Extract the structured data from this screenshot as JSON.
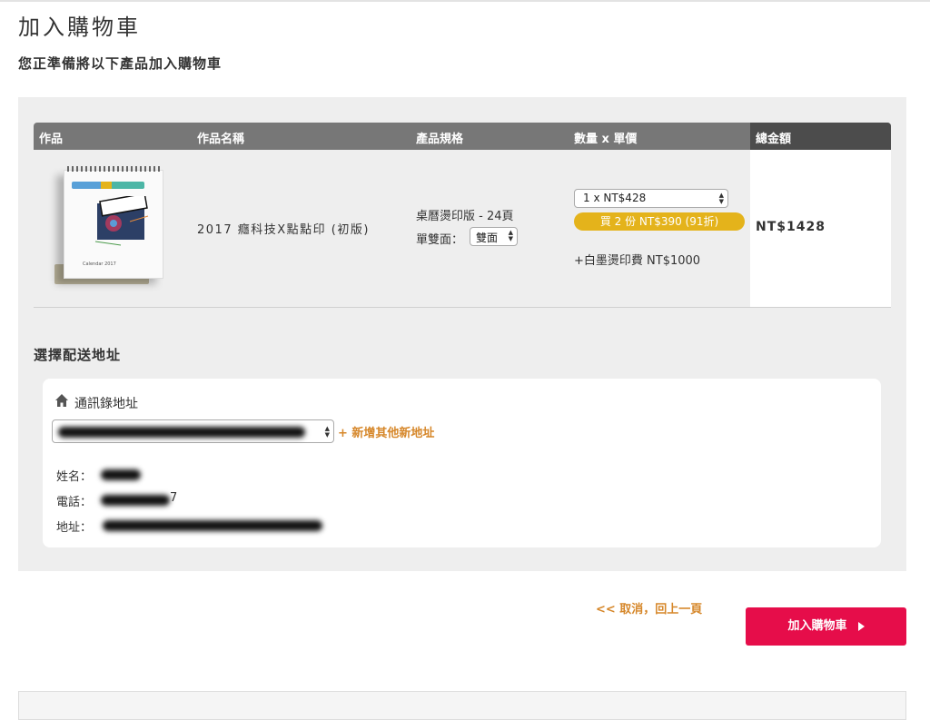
{
  "page": {
    "title": "加入購物車",
    "subtitle": "您正準備將以下產品加入購物車"
  },
  "table": {
    "headers": {
      "work": "作品",
      "name": "作品名稱",
      "spec": "產品規格",
      "qty_price": "數量 x 單價",
      "total": "總金額"
    },
    "row": {
      "thumbnail_caption": "Calendar 2017",
      "product_name": "2017 癮科技X點點印 (初版)",
      "spec_line": "桌曆燙印版 - 24頁",
      "sides_label": "單雙面：",
      "sides_value": "雙面",
      "qty_value": "1 x NT$428",
      "promo": "買 2 份 NT$390 (91折)",
      "extra_fee": "+白墨燙印費 NT$1000",
      "total": "NT$1428"
    }
  },
  "shipping": {
    "title": "選擇配送地址",
    "address_book_label": "通訊錄地址",
    "add_new_label": "+ 新增其他新地址",
    "fields": {
      "name_label": "姓名：",
      "phone_label": "電話：",
      "phone_tail": "7",
      "address_label": "地址："
    }
  },
  "actions": {
    "back_label": "<< 取消，回上一頁",
    "add_to_cart_label": "加入購物車"
  },
  "colors": {
    "accent_orange": "#d6872a",
    "promo_yellow": "#e4b31b",
    "primary_button": "#e60d4a",
    "table_header": "#777777",
    "table_header_dark": "#4c4c4c",
    "panel_bg": "#eeeeee"
  },
  "icons": {
    "home": "home-icon",
    "select_arrows": "select-arrows-icon",
    "button_arrow": "caret-right-icon"
  }
}
